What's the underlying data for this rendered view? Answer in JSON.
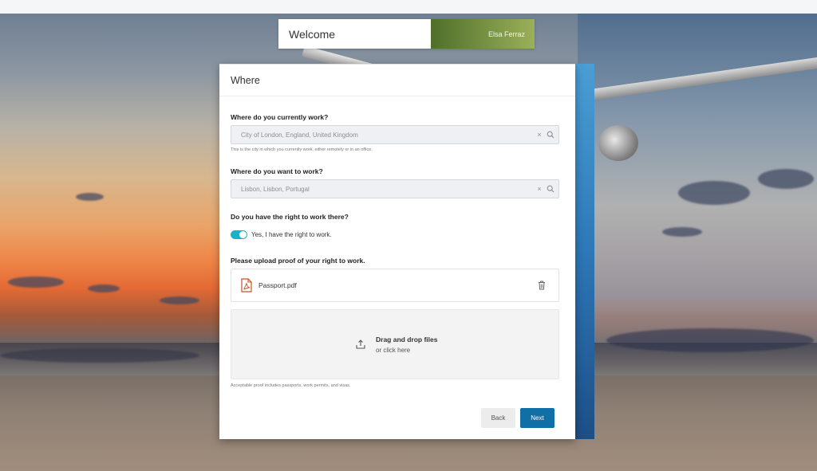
{
  "header": {
    "welcome_text": "Welcome",
    "user_name": "Elsa Ferraz",
    "accent_color": "#7a9444"
  },
  "card": {
    "title": "Where",
    "current_work": {
      "label": "Where do you currently work?",
      "value": "City of London, England, United Kingdom",
      "help": "This is the city in which you currently work, either remotely or in an office.",
      "clear_icon": "clear-icon",
      "search_icon": "search-icon"
    },
    "desired_work": {
      "label": "Where do you want to work?",
      "value": "Lisbon, Lisbon, Portugal",
      "clear_icon": "clear-icon",
      "search_icon": "search-icon"
    },
    "right_to_work": {
      "label": "Do you have the right to work there?",
      "toggle_on": true,
      "toggle_text": "Yes, I have the right to work.",
      "toggle_color": "#1ab2c8"
    },
    "upload": {
      "label": "Please upload proof of your right to work.",
      "file_name": "Passport.pdf",
      "file_icon": "pdf-file-icon",
      "delete_icon": "trash-icon",
      "dropzone_title": "Drag and drop files",
      "dropzone_sub": "or click here",
      "dropzone_icon": "upload-icon",
      "help": "Acceptable proof includes passports, work permits, and visas."
    },
    "buttons": {
      "back": "Back",
      "next": "Next",
      "next_color": "#0f6fa6"
    }
  }
}
